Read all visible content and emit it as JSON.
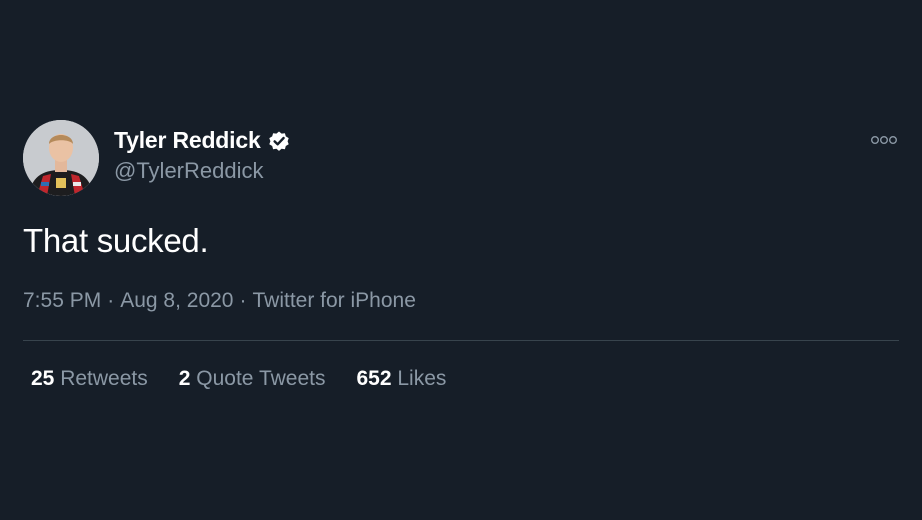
{
  "author": {
    "display_name": "Tyler Reddick",
    "handle": "@TylerReddick",
    "verified": true
  },
  "tweet": {
    "text": "That sucked."
  },
  "meta": {
    "time": "7:55 PM",
    "date": "Aug 8, 2020",
    "source": "Twitter for iPhone",
    "separator": "·"
  },
  "stats": [
    {
      "count": "25",
      "label": "Retweets"
    },
    {
      "count": "2",
      "label": "Quote Tweets"
    },
    {
      "count": "652",
      "label": "Likes"
    }
  ],
  "colors": {
    "background": "#161e28",
    "primary_text": "#ffffff",
    "secondary_text": "#8b98a5",
    "divider": "#38444d"
  },
  "icons": {
    "verified": "verified-badge-icon",
    "more": "more-options-icon"
  }
}
